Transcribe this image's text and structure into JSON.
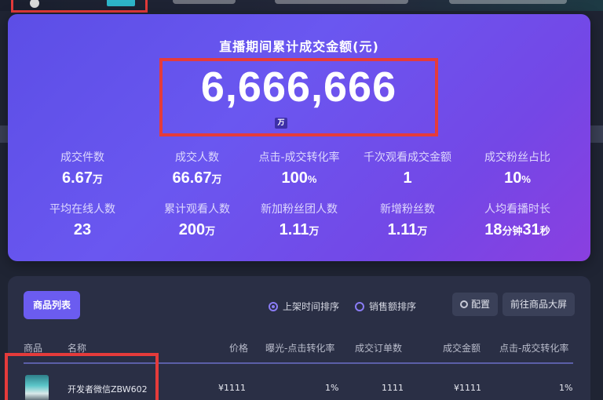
{
  "hero": {
    "title": "直播期间累计成交金额(元)",
    "amount": "6,666,666",
    "unit": "万"
  },
  "stats": [
    {
      "label": "成交件数",
      "value": "6.67",
      "unit": "万"
    },
    {
      "label": "成交人数",
      "value": "66.67",
      "unit": "万"
    },
    {
      "label": "点击-成交转化率",
      "value": "100",
      "unit": "%"
    },
    {
      "label": "千次观看成交金额",
      "value": "1",
      "unit": ""
    },
    {
      "label": "成交粉丝占比",
      "value": "10",
      "unit": "%"
    },
    {
      "label": "平均在线人数",
      "value": "23",
      "unit": ""
    },
    {
      "label": "累计观看人数",
      "value": "200",
      "unit": "万"
    },
    {
      "label": "新加粉丝团人数",
      "value": "1.11",
      "unit": "万"
    },
    {
      "label": "新增粉丝数",
      "value": "1.11",
      "unit": "万"
    },
    {
      "label": "人均看播时长",
      "value": "18",
      "unit": "分钟",
      "value2": "31",
      "unit2": "秒"
    }
  ],
  "products": {
    "list_button": "商品列表",
    "sort_options": [
      {
        "label": "上架时间排序",
        "checked": true
      },
      {
        "label": "销售额排序",
        "checked": false
      }
    ],
    "config_button": "配置",
    "screen_button": "前往商品大屏",
    "columns": [
      "商品",
      "名称",
      "价格",
      "曝光-点击转化率",
      "成交订单数",
      "成交金额",
      "点击-成交转化率"
    ],
    "rows": [
      {
        "name": "开发者微信ZBW602",
        "price": "¥1111",
        "exposure_rate": "1%",
        "orders": "1111",
        "amount": "¥1111",
        "conversion": "1%"
      }
    ]
  },
  "colors": {
    "hero_gradient_start": "#5c4ee6",
    "hero_gradient_end": "#8a3fe0",
    "highlight_box": "#e53b3b",
    "accent": "#6b5cf0"
  }
}
